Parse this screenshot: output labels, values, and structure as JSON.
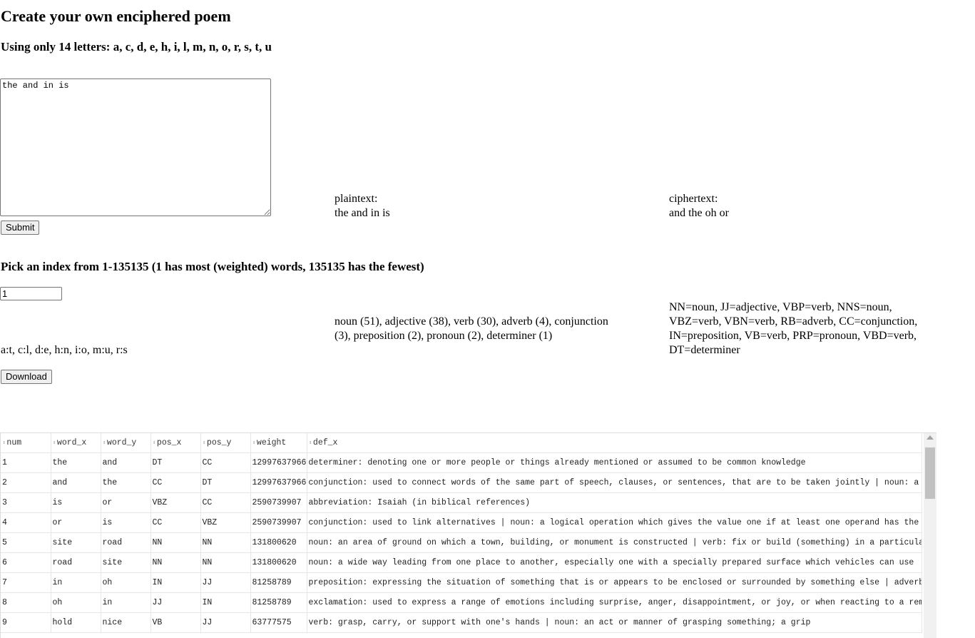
{
  "header": {
    "title": "Create your own enciphered poem",
    "letters_heading": "Using only 14 letters: a, c, d, e, h, i, l, m, n, o, r, s, t, u"
  },
  "poem_input": {
    "value": "the and in is"
  },
  "submit_label": "Submit",
  "plaintext": {
    "label": "plaintext:",
    "value": "the and in is"
  },
  "ciphertext": {
    "label": "ciphertext:",
    "value": "and the oh or"
  },
  "index_heading": "Pick an index from 1-135135 (1 has most (weighted) words, 135135 has the fewest)",
  "index_input": {
    "value": "1"
  },
  "mapping_text": "a:t, c:l, d:e, h:n, i:o, m:u, r:s",
  "pos_counts_text": "noun (51), adjective (38), verb (30), adverb (4), conjunction (3), preposition (2), pronoun (2), determiner (1)",
  "pos_legend_text": "NN=noun, JJ=adjective, VBP=verb, NNS=noun, VBZ=verb, VBN=verb, RB=adverb, CC=conjunction, IN=preposition, VB=verb, PRP=pronoun, VBD=verb, DT=determiner",
  "download_label": "Download",
  "table": {
    "columns": [
      "num",
      "word_x",
      "word_y",
      "pos_x",
      "pos_y",
      "weight",
      "def_x"
    ],
    "rows": [
      [
        "1",
        "the",
        "and",
        "DT",
        "CC",
        "12997637966",
        "determiner: denoting one or more people or things already mentioned or assumed to be common knowledge"
      ],
      [
        "2",
        "and",
        "the",
        "CC",
        "DT",
        "12997637966",
        "conjunction: used to connect words of the same part of speech, clauses, or sentences, that are to be taken jointly | noun: a Boo"
      ],
      [
        "3",
        "is",
        "or",
        "VBZ",
        "CC",
        "2590739907",
        "abbreviation: Isaiah (in biblical references)"
      ],
      [
        "4",
        "or",
        "is",
        "CC",
        "VBZ",
        "2590739907",
        "conjunction: used to link alternatives | noun: a logical operation which gives the value one if at least one operand has the valu"
      ],
      [
        "5",
        "site",
        "road",
        "NN",
        "NN",
        "131800620",
        "noun: an area of ground on which a town, building, or monument is constructed | verb: fix or build (something) in a particular pl"
      ],
      [
        "6",
        "road",
        "site",
        "NN",
        "NN",
        "131800620",
        "noun: a wide way leading from one place to another, especially one with a specially prepared surface which vehicles can use"
      ],
      [
        "7",
        "in",
        "oh",
        "IN",
        "JJ",
        "81258789",
        "preposition: expressing the situation of something that is or appears to be enclosed or surrounded by something else | adverb: ex"
      ],
      [
        "8",
        "oh",
        "in",
        "JJ",
        "IN",
        "81258789",
        "exclamation: used to express a range of emotions including surprise, anger, disappointment, or joy, or when reacting to a remark"
      ],
      [
        "9",
        "hold",
        "nice",
        "VB",
        "JJ",
        "63777575",
        "verb: grasp, carry, or support with one's hands | noun: an act or manner of grasping something; a grip"
      ]
    ]
  }
}
